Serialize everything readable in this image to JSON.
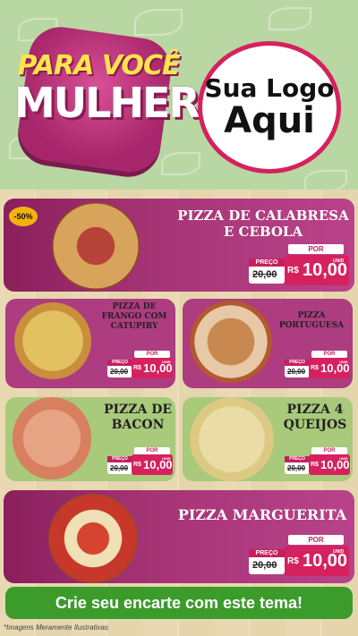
{
  "header": {
    "badge_line1": "PARA VOCÊ",
    "badge_line2": "MULHER",
    "logo_line1": "Sua Logo",
    "logo_line2": "Aqui"
  },
  "discount_badge": "-50%",
  "products": [
    {
      "name": "PIZZA DE CALABRESA E CEBOLA",
      "preco_label": "PREÇO",
      "old_price": "20,00",
      "por_label": "POR",
      "currency": "R$",
      "new_price": "10,00",
      "unit": "UNID"
    },
    {
      "name": "PIZZA DE FRANGO COM CATUPIRY",
      "preco_label": "PREÇO",
      "old_price": "20,00",
      "por_label": "POR",
      "currency": "R$",
      "new_price": "10,00",
      "unit": "UNID"
    },
    {
      "name": "PIZZA PORTUGUESA",
      "preco_label": "PREÇO",
      "old_price": "20,00",
      "por_label": "POR",
      "currency": "R$",
      "new_price": "10,00",
      "unit": "UNID"
    },
    {
      "name": "PIZZA DE BACON",
      "preco_label": "PREÇO",
      "old_price": "20,00",
      "por_label": "POR",
      "currency": "R$",
      "new_price": "10,00",
      "unit": "UNID"
    },
    {
      "name": "PIZZA 4 QUEIJOS",
      "preco_label": "PREÇO",
      "old_price": "20,00",
      "por_label": "POR",
      "currency": "R$",
      "new_price": "10,00",
      "unit": "UNID"
    },
    {
      "name": "PIZZA MARGUERITA",
      "preco_label": "PREÇO",
      "old_price": "20,00",
      "por_label": "POR",
      "currency": "R$",
      "new_price": "10,00",
      "unit": "UNID"
    }
  ],
  "cta": "Crie seu encarte com este tema!",
  "footer_note": "*Imagens Meramente Ilustrativas",
  "colors": {
    "magenta": "#d6215f",
    "purple": "#a43374",
    "green": "#3b9b2b",
    "gold": "#f4b20f"
  }
}
